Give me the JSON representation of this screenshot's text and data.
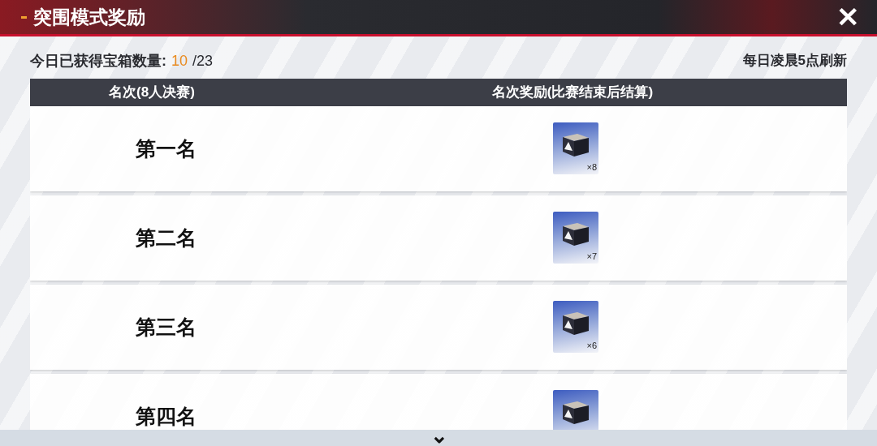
{
  "window": {
    "title": "突围模式奖励",
    "close": "✕"
  },
  "stats": {
    "label": "今日已获得宝箱数量:",
    "obtained": "10",
    "total": "/23",
    "refresh_note": "每日凌晨5点刷新"
  },
  "table": {
    "columns": [
      "名次(8人决赛)",
      "名次奖励(比赛结束后结算)"
    ],
    "rows": [
      {
        "rank": "第一名",
        "reward_count": "×8"
      },
      {
        "rank": "第二名",
        "reward_count": "×7"
      },
      {
        "rank": "第三名",
        "reward_count": "×6"
      },
      {
        "rank": "第四名"
      }
    ]
  },
  "scroll_hint": "⌄"
}
